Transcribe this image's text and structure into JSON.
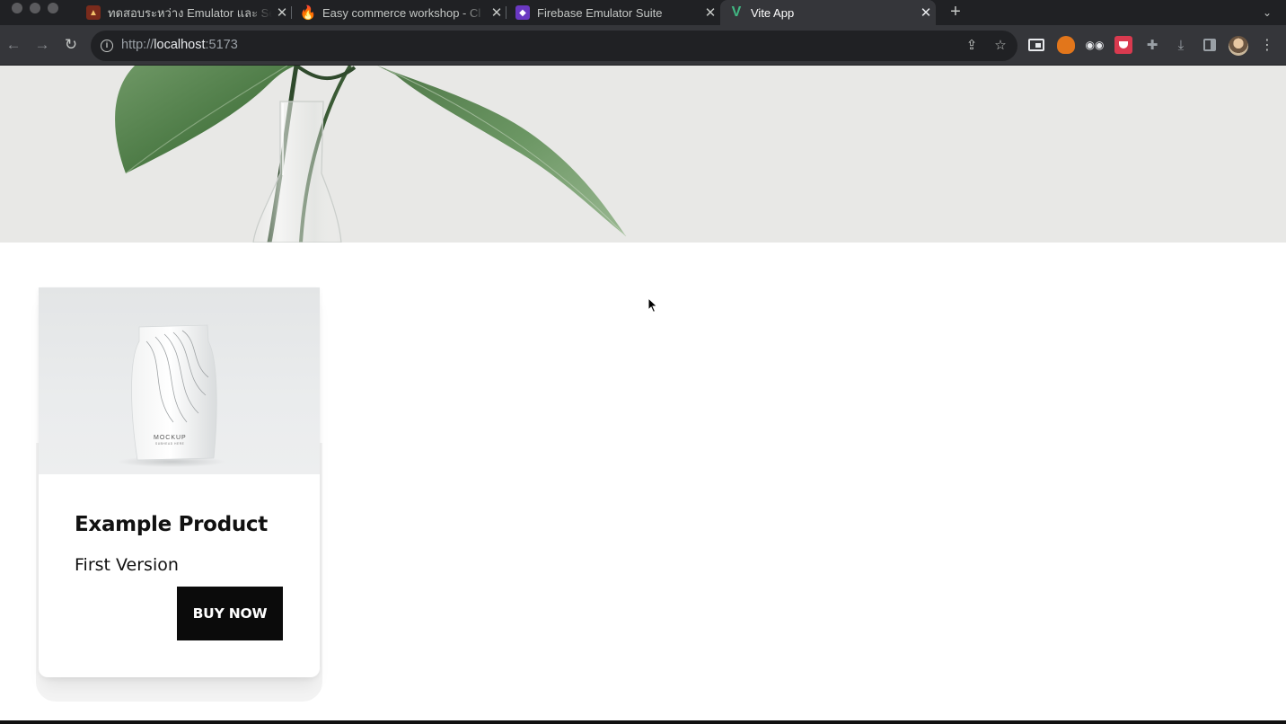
{
  "browser": {
    "tabs": [
      {
        "title": "ทดสอบระหว่าง Emulator และ Se",
        "close": "✕"
      },
      {
        "title": "Easy commerce workshop - Cl",
        "close": "✕"
      },
      {
        "title": "Firebase Emulator Suite",
        "close": "✕"
      },
      {
        "title": "Vite App",
        "close": "✕",
        "active": true
      }
    ],
    "new_tab": "+",
    "tab_list": "⌄",
    "nav": {
      "back": "←",
      "forward": "→",
      "reload": "↻"
    },
    "url_scheme": "http://",
    "url_host": "localhost",
    "url_port": ":5173",
    "omnibox_icons": {
      "share": "⇪",
      "bookmark": "☆"
    },
    "extensions": [
      "tab-search-icon",
      "metamask-icon",
      "glasses-icon",
      "pocket-icon",
      "puzzle-icon",
      "download-icon",
      "sidepanel-icon"
    ],
    "menu": "⋮"
  },
  "product": {
    "name": "Example Product",
    "version": "First Version",
    "buy_label": "BUY NOW",
    "mockup_text": "MOCKUP",
    "mockup_subtext": "SUBHEAD HERE"
  },
  "colors": {
    "button_bg": "#0b0b0b",
    "hero_bg": "#e8e8e6",
    "leaf": "#4e7a45"
  }
}
